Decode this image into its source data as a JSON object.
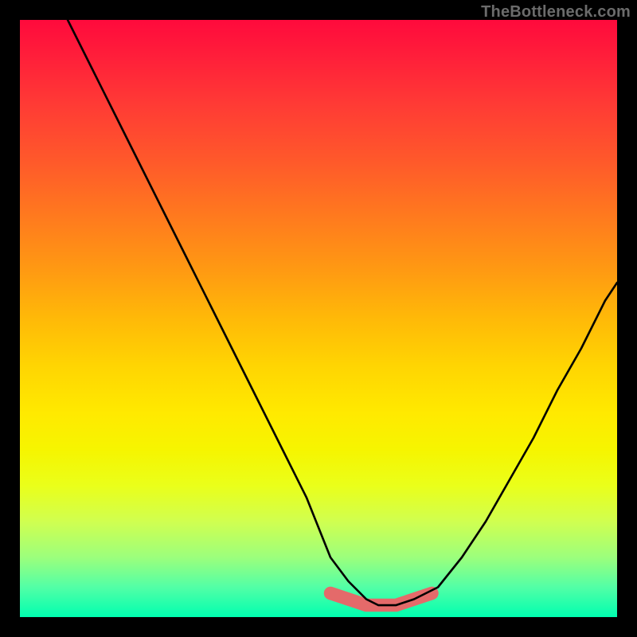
{
  "watermark": "TheBottleneck.com",
  "chart_data": {
    "type": "line",
    "title": "",
    "xlabel": "",
    "ylabel": "",
    "xlim": [
      0,
      100
    ],
    "ylim": [
      0,
      100
    ],
    "series": [
      {
        "name": "bottleneck-curve",
        "x": [
          8,
          12,
          16,
          20,
          24,
          28,
          32,
          36,
          40,
          44,
          48,
          50,
          52,
          55,
          58,
          60,
          63,
          66,
          70,
          74,
          78,
          82,
          86,
          90,
          94,
          98,
          100
        ],
        "values": [
          100,
          92,
          84,
          76,
          68,
          60,
          52,
          44,
          36,
          28,
          20,
          15,
          10,
          6,
          3,
          2,
          2,
          3,
          5,
          10,
          16,
          23,
          30,
          38,
          45,
          53,
          56
        ]
      },
      {
        "name": "highlight-band",
        "x": [
          52,
          55,
          58,
          60,
          63,
          66,
          69
        ],
        "values": [
          4,
          3,
          2,
          2,
          2,
          3,
          4
        ]
      }
    ],
    "colors": {
      "curve": "#000000",
      "highlight": "#e46a6a",
      "gradient_top": "#ff0a3c",
      "gradient_bottom": "#00ffb0"
    }
  }
}
